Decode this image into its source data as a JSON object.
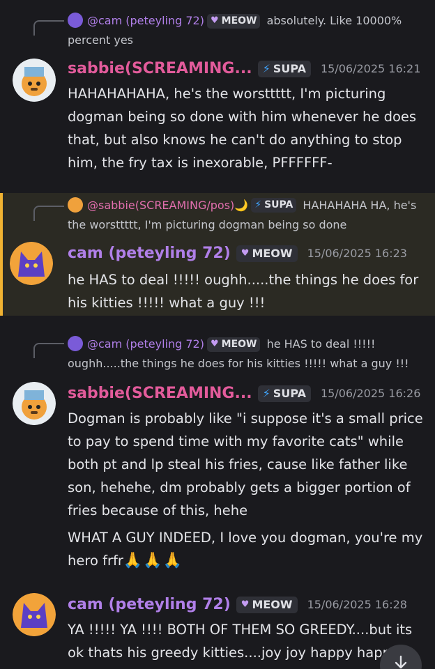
{
  "messages": [
    {
      "reply": {
        "mention": "@cam (peteyling 72)",
        "tag": "MEOW",
        "text": "absolutely. Like 10000% percent yes"
      },
      "author": "sabbie(SCREAMING...",
      "tag": "SUPA",
      "time": "15/06/2025 16:21",
      "paragraphs": [
        "HAHAHAHAHA, he's the worsttttt, I'm picturing dogman being so done with him whenever he does that, but also knows he can't do anything to stop him, the fry tax is inexorable, PFFFFFF-"
      ]
    },
    {
      "reply": {
        "mention": "@sabbie(SCREAMING/pos)🌙",
        "tag": "SUPA",
        "text": "HAHAHAHA HA, he's the worsttttt, I'm picturing dogman being so done"
      },
      "author": "cam (peteyling 72)",
      "tag": "MEOW",
      "time": "15/06/2025 16:23",
      "paragraphs": [
        "he HAS to deal !!!!! oughh.....the things he does for his kitties !!!!! what a guy !!!"
      ]
    },
    {
      "reply": {
        "mention": "@cam (peteyling 72)",
        "tag": "MEOW",
        "text": "he HAS to deal !!!!! oughh.....the things he does for his kitties !!!!! what a guy !!!"
      },
      "author": "sabbie(SCREAMING...",
      "tag": "SUPA",
      "time": "15/06/2025 16:26",
      "paragraphs": [
        "Dogman is probably like \"i suppose it's a small price to pay to spend time with my favorite cats\" while both pt and lp steal his fries, cause like father like son, hehehe, dm probably gets a bigger portion of fries because of this, hehe",
        "WHAT A GUY INDEED, I love you dogman, you're my hero frfr",
        "🙏🙏🙏"
      ]
    },
    {
      "author": "cam (peteyling 72)",
      "tag": "MEOW",
      "time": "15/06/2025 16:28",
      "paragraphs": [
        "YA !!!!! YA !!!! BOTH OF THEM SO GREEDY....but its ok thats his greedy kitties....joy joy happy happy"
      ]
    }
  ],
  "icons": {
    "meow_badge": "heart-icon",
    "supa_badge": "lightning-icon",
    "scroll": "arrow-down-icon"
  },
  "colors": {
    "background": "#1a1a1e",
    "highlight": "#2b2a23",
    "highlight_bar": "#f0b232",
    "sabbie_name": "#e25b9b",
    "cam_name": "#b07fe8"
  }
}
